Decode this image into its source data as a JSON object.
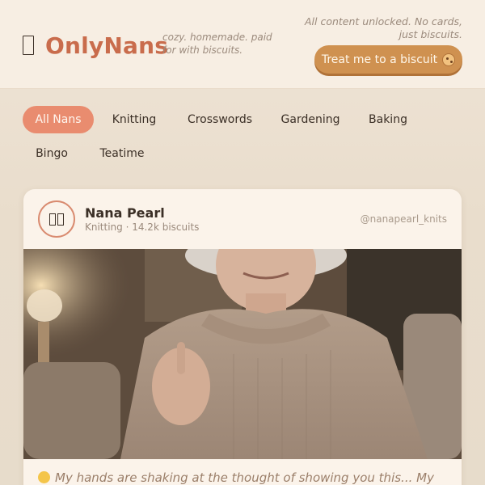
{
  "header": {
    "brand_name": "OnlyNans",
    "tagline": "cozy. homemade. paid for with biscuits.",
    "note": "All content unlocked. No cards, just biscuits.",
    "treat_button_label": "Treat me to a biscuit",
    "treat_button_icon": "cookie-icon"
  },
  "categories": {
    "items": [
      {
        "label": "All Nans",
        "active": true
      },
      {
        "label": "Knitting",
        "active": false
      },
      {
        "label": "Crosswords",
        "active": false
      },
      {
        "label": "Gardening",
        "active": false
      },
      {
        "label": "Baking",
        "active": false
      },
      {
        "label": "Bingo",
        "active": false
      },
      {
        "label": "Teatime",
        "active": false
      }
    ]
  },
  "post": {
    "author_name": "Nana Pearl",
    "author_meta": "Knitting · 14.2k biscuits",
    "handle": "@nanapearl_knits",
    "caption": "My hands are shaking at the thought of showing you this... My"
  },
  "colors": {
    "accent": "#c96c4c",
    "pill_active": "#e98c6f",
    "button": "#cf9150"
  }
}
